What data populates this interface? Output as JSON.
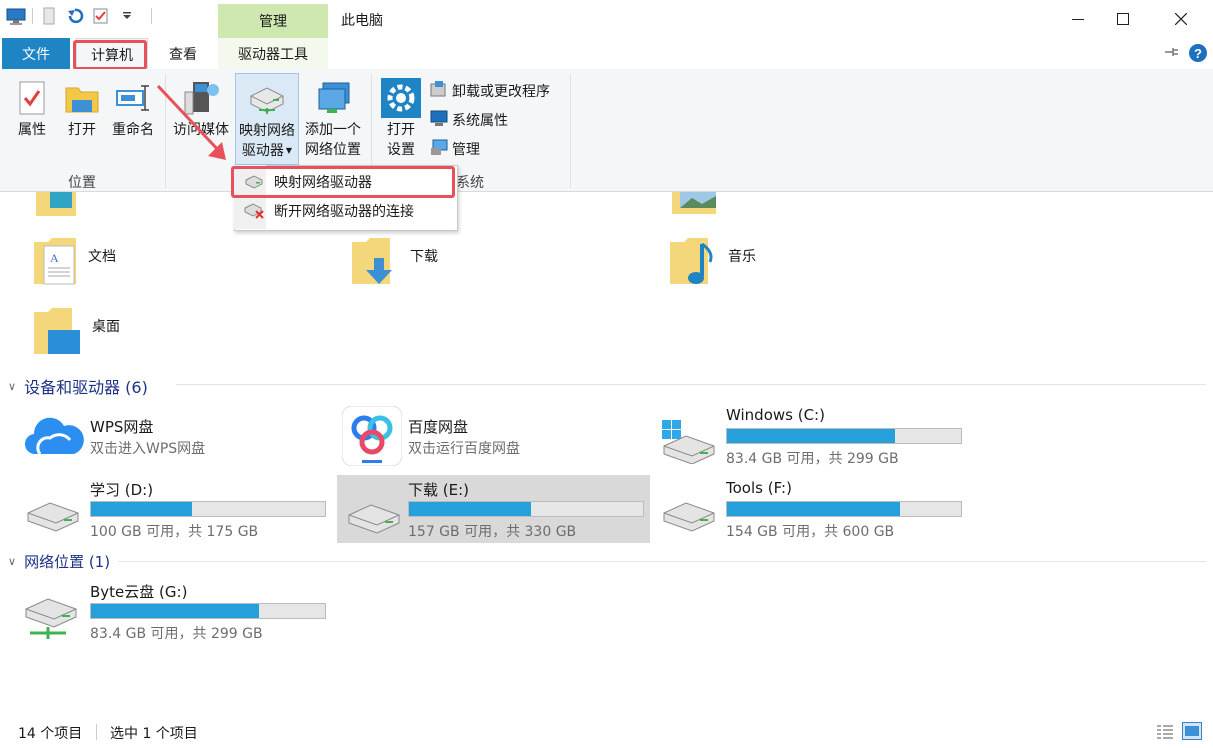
{
  "window": {
    "title": "此电脑",
    "context_group": "管理"
  },
  "tabs": {
    "file": "文件",
    "computer": "计算机",
    "view": "查看",
    "drive_tools": "驱动器工具"
  },
  "ribbon": {
    "location_group": {
      "label": "位置",
      "properties": "属性",
      "open": "打开",
      "rename": "重命名"
    },
    "network_group": {
      "access_media": "访问媒体",
      "map_drive_line1": "映射网络",
      "map_drive_line2": "驱动器",
      "add_location_line1": "添加一个",
      "add_location_line2": "网络位置"
    },
    "system_group": {
      "label": "系统",
      "open_settings_line1": "打开",
      "open_settings_line2": "设置",
      "uninstall": "卸载或更改程序",
      "system_properties": "系统属性",
      "manage": "管理"
    }
  },
  "dropdown": {
    "items": [
      "映射网络驱动器",
      "断开网络驱动器的连接"
    ]
  },
  "folders": [
    {
      "name": "文档"
    },
    {
      "name": "下载"
    },
    {
      "name": "音乐"
    },
    {
      "name": "桌面"
    }
  ],
  "sections": {
    "devices": "设备和驱动器 (6)",
    "network": "网络位置 (1)"
  },
  "apps": [
    {
      "name": "WPS网盘",
      "sub": "双击进入WPS网盘"
    },
    {
      "name": "百度网盘",
      "sub": "双击运行百度网盘"
    }
  ],
  "drives": [
    {
      "name": "Windows (C:)",
      "info": "83.4 GB 可用，共 299 GB",
      "used_fraction": 0.72
    },
    {
      "name": "学习 (D:)",
      "info": "100 GB 可用，共 175 GB",
      "used_fraction": 0.43
    },
    {
      "name": "下载 (E:)",
      "info": "157 GB 可用，共 330 GB",
      "used_fraction": 0.52
    },
    {
      "name": "Tools (F:)",
      "info": "154 GB 可用，共 600 GB",
      "used_fraction": 0.74
    }
  ],
  "network_drives": [
    {
      "name": "Byte云盘 (G:)",
      "info": "83.4 GB 可用，共 299 GB",
      "used_fraction": 0.72
    }
  ],
  "status": {
    "items": "14 个项目",
    "selected": "选中 1 个项目"
  },
  "colors": {
    "accent": "#1f84c4",
    "drive_bar": "#26a0da",
    "highlight": "#e8505b",
    "context_tab": "#cfe8b0",
    "section_head": "#1e3287"
  }
}
